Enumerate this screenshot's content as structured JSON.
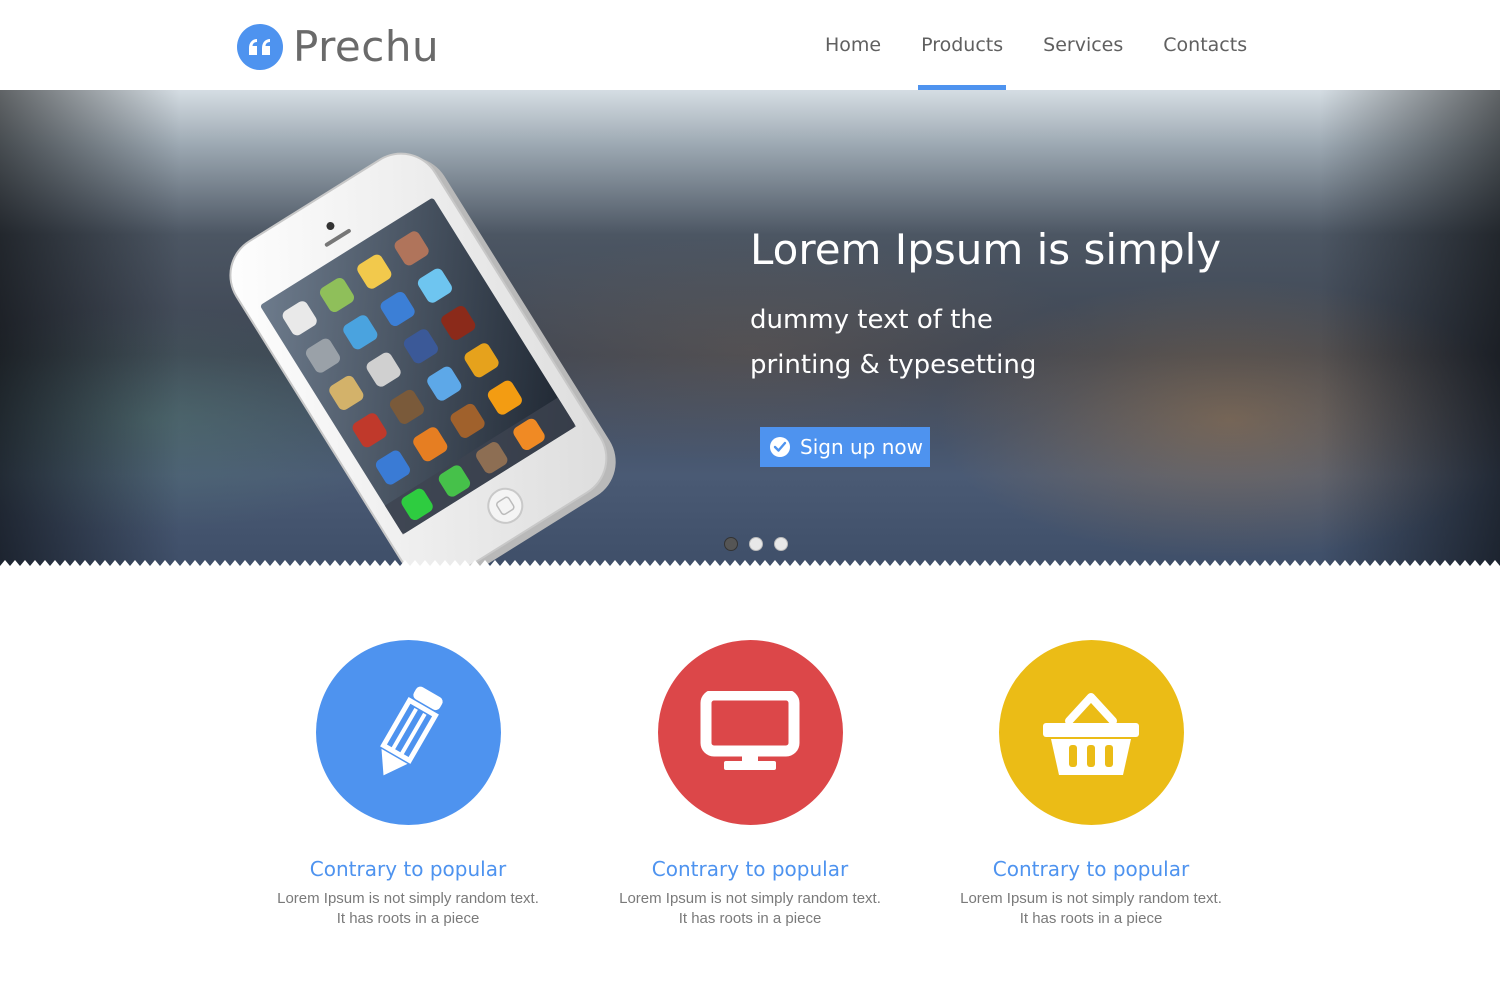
{
  "header": {
    "logo_text": "Prechu",
    "nav": [
      {
        "label": "Home"
      },
      {
        "label": "Products"
      },
      {
        "label": "Services"
      },
      {
        "label": "Contacts"
      }
    ],
    "active_nav": "Products"
  },
  "hero": {
    "title": "Lorem Ipsum is simply",
    "subtitle_line1": "dummy text of the",
    "subtitle_line2": "printing & typesetting",
    "cta_label": "Sign up now",
    "slides_count": 3,
    "active_slide": 1
  },
  "features": [
    {
      "icon": "pencil-icon",
      "color": "#4e93ef",
      "title": "Contrary to popular",
      "text_line1": "Lorem Ipsum is not simply random text.",
      "text_line2": "It has roots in a piece"
    },
    {
      "icon": "monitor-icon",
      "color": "#dc4749",
      "title": "Contrary to popular",
      "text_line1": "Lorem Ipsum is not simply random text.",
      "text_line2": "It has roots in a piece"
    },
    {
      "icon": "basket-icon",
      "color": "#ebbc16",
      "title": "Contrary to popular",
      "text_line1": "Lorem Ipsum is not simply random text.",
      "text_line2": "It has roots in a piece"
    }
  ],
  "colors": {
    "accent": "#4e93ef",
    "red": "#dc4749",
    "yellow": "#ebbc16"
  }
}
